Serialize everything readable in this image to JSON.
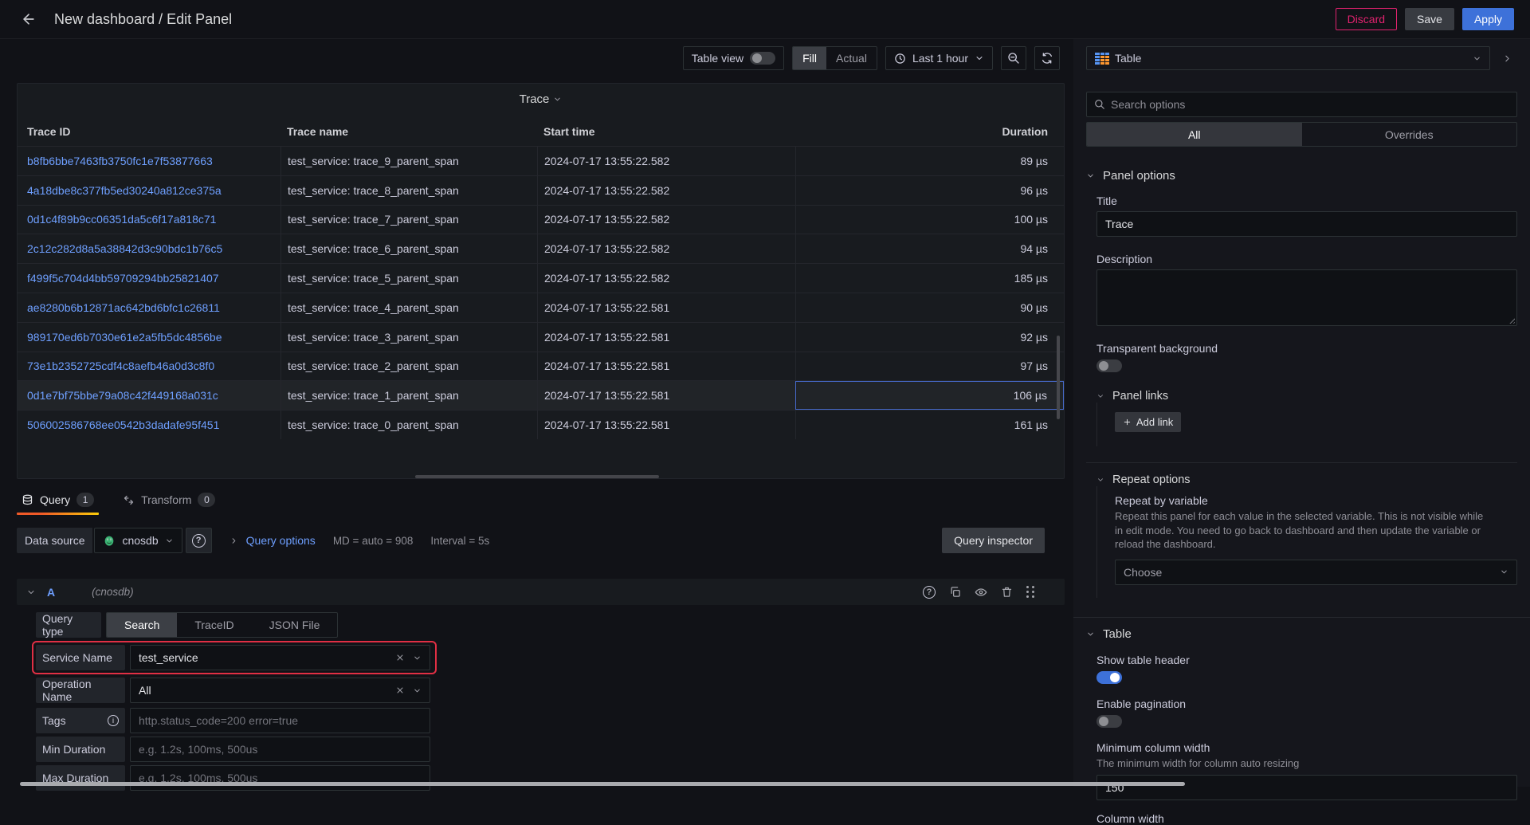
{
  "header": {
    "title": "New dashboard / Edit Panel",
    "discard_label": "Discard",
    "save_label": "Save",
    "apply_label": "Apply"
  },
  "toolbar": {
    "table_view_label": "Table view",
    "fill_label": "Fill",
    "actual_label": "Actual",
    "time_range": "Last 1 hour"
  },
  "trace_panel": {
    "title": "Trace",
    "columns": [
      "Trace ID",
      "Trace name",
      "Start time",
      "Duration"
    ],
    "selected_row_index": 8,
    "rows": [
      {
        "id": "b8fb6bbe7463fb3750fc1e7f53877663",
        "name": "test_service: trace_9_parent_span",
        "start": "2024-07-17 13:55:22.582",
        "duration": "89 µs"
      },
      {
        "id": "4a18dbe8c377fb5ed30240a812ce375a",
        "name": "test_service: trace_8_parent_span",
        "start": "2024-07-17 13:55:22.582",
        "duration": "96 µs"
      },
      {
        "id": "0d1c4f89b9cc06351da5c6f17a818c71",
        "name": "test_service: trace_7_parent_span",
        "start": "2024-07-17 13:55:22.582",
        "duration": "100 µs"
      },
      {
        "id": "2c12c282d8a5a38842d3c90bdc1b76c5",
        "name": "test_service: trace_6_parent_span",
        "start": "2024-07-17 13:55:22.582",
        "duration": "94 µs"
      },
      {
        "id": "f499f5c704d4bb59709294bb25821407",
        "name": "test_service: trace_5_parent_span",
        "start": "2024-07-17 13:55:22.582",
        "duration": "185 µs"
      },
      {
        "id": "ae8280b6b12871ac642bd6bfc1c26811",
        "name": "test_service: trace_4_parent_span",
        "start": "2024-07-17 13:55:22.581",
        "duration": "90 µs"
      },
      {
        "id": "989170ed6b7030e61e2a5fb5dc4856be",
        "name": "test_service: trace_3_parent_span",
        "start": "2024-07-17 13:55:22.581",
        "duration": "92 µs"
      },
      {
        "id": "73e1b2352725cdf4c8aefb46a0d3c8f0",
        "name": "test_service: trace_2_parent_span",
        "start": "2024-07-17 13:55:22.581",
        "duration": "97 µs"
      },
      {
        "id": "0d1e7bf75bbe79a08c42f449168a031c",
        "name": "test_service: trace_1_parent_span",
        "start": "2024-07-17 13:55:22.581",
        "duration": "106 µs"
      },
      {
        "id": "506002586768ee0542b3dadafe95f451",
        "name": "test_service: trace_0_parent_span",
        "start": "2024-07-17 13:55:22.581",
        "duration": "161 µs"
      }
    ]
  },
  "query_section": {
    "query_tab": "Query",
    "query_count": "1",
    "transform_tab": "Transform",
    "transform_count": "0"
  },
  "datasource_bar": {
    "label": "Data source",
    "name": "cnosdb",
    "query_options_label": "Query options",
    "md_text": "MD = auto = 908",
    "interval_text": "Interval = 5s",
    "inspector_label": "Query inspector"
  },
  "query_editor": {
    "ref_id": "A",
    "ds_hint": "(cnosdb)",
    "query_type_label": "Query type",
    "types": {
      "search": "Search",
      "traceid": "TraceID",
      "json": "JSON File"
    },
    "service_name": {
      "label": "Service Name",
      "value": "test_service"
    },
    "operation_name": {
      "label": "Operation Name",
      "value": "All"
    },
    "tags": {
      "label": "Tags",
      "placeholder": "http.status_code=200 error=true"
    },
    "min_duration": {
      "label": "Min Duration",
      "placeholder": "e.g. 1.2s, 100ms, 500us"
    },
    "max_duration": {
      "label": "Max Duration",
      "placeholder": "e.g. 1.2s, 100ms, 500us"
    }
  },
  "sidebar": {
    "viz_type": "Table",
    "search_placeholder": "Search options",
    "tab_all": "All",
    "tab_overrides": "Overrides",
    "panel_options": {
      "title": "Panel options",
      "title_label": "Title",
      "title_value": "Trace",
      "description_label": "Description",
      "transparent_label": "Transparent background"
    },
    "panel_links": {
      "title": "Panel links",
      "add_link_label": "Add link"
    },
    "repeat_options": {
      "title": "Repeat options",
      "repeat_label": "Repeat by variable",
      "repeat_desc": "Repeat this panel for each value in the selected variable. This is not visible while in edit mode. You need to go back to dashboard and then update the variable or reload the dashboard.",
      "choose_placeholder": "Choose"
    },
    "table_options": {
      "title": "Table",
      "show_header_label": "Show table header",
      "pagination_label": "Enable pagination",
      "min_col_width_label": "Minimum column width",
      "min_col_width_desc": "The minimum width for column auto resizing",
      "min_col_width_value": "150",
      "col_width_label": "Column width"
    }
  }
}
